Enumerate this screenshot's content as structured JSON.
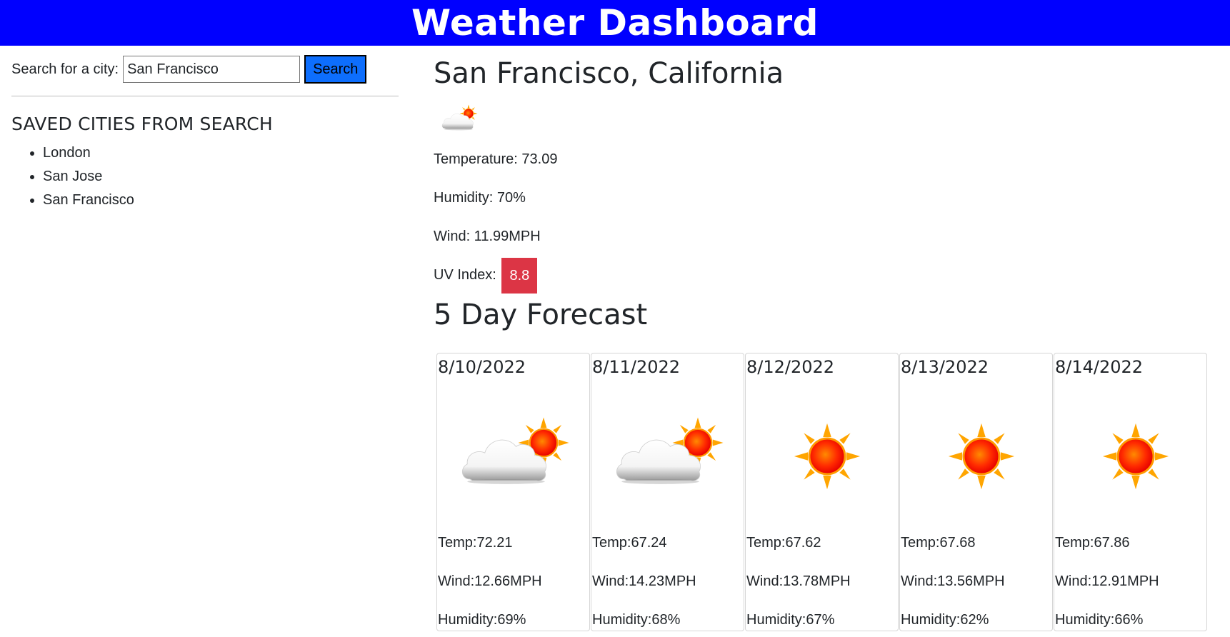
{
  "header": {
    "title": "Weather Dashboard"
  },
  "search": {
    "label": "Search for a city:",
    "value": "San Francisco",
    "button_label": "Search"
  },
  "saved": {
    "title": "SAVED CITIES FROM SEARCH",
    "cities": [
      "London",
      "San Jose",
      "San Francisco"
    ]
  },
  "current": {
    "city": "San Francisco, California",
    "icon": "partly-cloudy-icon",
    "temperature": "Temperature: 73.09",
    "humidity": "Humidity: 70%",
    "wind": "Wind: 11.99MPH",
    "uv_label": "UV Index:",
    "uv_value": "8.8",
    "uv_color": "#dc3545"
  },
  "forecast": {
    "title": "5 Day Forecast",
    "days": [
      {
        "date": "8/10/2022",
        "icon": "partly-cloudy-icon",
        "temp": "Temp:72.21",
        "wind": "Wind:12.66MPH",
        "humidity": "Humidity:69%"
      },
      {
        "date": "8/11/2022",
        "icon": "partly-cloudy-icon",
        "temp": "Temp:67.24",
        "wind": "Wind:14.23MPH",
        "humidity": "Humidity:68%"
      },
      {
        "date": "8/12/2022",
        "icon": "sun-icon",
        "temp": "Temp:67.62",
        "wind": "Wind:13.78MPH",
        "humidity": "Humidity:67%"
      },
      {
        "date": "8/13/2022",
        "icon": "sun-icon",
        "temp": "Temp:67.68",
        "wind": "Wind:13.56MPH",
        "humidity": "Humidity:62%"
      },
      {
        "date": "8/14/2022",
        "icon": "sun-icon",
        "temp": "Temp:67.86",
        "wind": "Wind:12.91MPH",
        "humidity": "Humidity:66%"
      }
    ]
  },
  "colors": {
    "header_bg": "#0000ff",
    "button_bg": "#0d6efd",
    "uv_badge": "#dc3545"
  }
}
